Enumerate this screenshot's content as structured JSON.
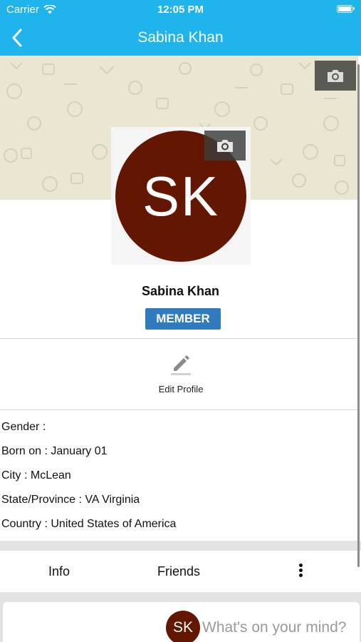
{
  "status_bar": {
    "carrier": "Carrier",
    "time": "12:05 PM"
  },
  "nav": {
    "title": "Sabina Khan"
  },
  "profile": {
    "initials": "SK",
    "name": "Sabina Khan",
    "badge": "MEMBER",
    "avatar_color": "#631600"
  },
  "actions": {
    "edit_profile": "Edit Profile"
  },
  "details": [
    "Gender :",
    "Born on : January 01",
    "City : McLean",
    "State/Province : VA Virginia",
    "Country : United States of America"
  ],
  "tabs": {
    "info": "Info",
    "friends": "Friends"
  },
  "composer": {
    "initials": "SK",
    "placeholder": "What's on your mind?"
  },
  "colors": {
    "header": "#1fb5ec",
    "badge": "#2f7bbd",
    "cover": "#ebe6d2"
  }
}
